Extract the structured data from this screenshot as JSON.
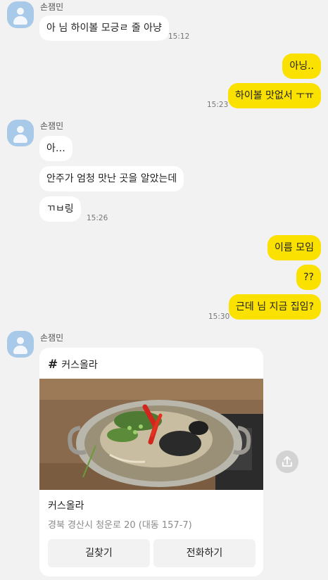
{
  "groups": [
    {
      "sender": "손잼민",
      "messages": [
        {
          "text": "아 님 하이볼 모긍ㄹ 줄 아냥",
          "time": "15:12"
        }
      ]
    },
    {
      "sender": "me",
      "messages": [
        {
          "text": "아닝.."
        },
        {
          "text": "하이볼 맛없서 ㅜㅠ",
          "time": "15:23"
        }
      ]
    },
    {
      "sender": "손잼민",
      "messages": [
        {
          "text": "아…"
        },
        {
          "text": "안주가 엄청 맛난 곳을 알았는데"
        },
        {
          "text": "ㄲㅂ링",
          "time": "15:26"
        }
      ]
    },
    {
      "sender": "me",
      "messages": [
        {
          "text": "이름 모임"
        },
        {
          "text": "??"
        },
        {
          "text": "근데 님 지금 집임?",
          "time": "15:30"
        }
      ]
    },
    {
      "sender": "손잼민",
      "place_card": {
        "hash": "#",
        "title": "커스올라",
        "place_name": "커스올라",
        "address": "경북 경산시 청운로 20 (대동 157-7)",
        "buttons": [
          "길찾기",
          "전화하기"
        ]
      }
    }
  ],
  "icons": {
    "avatar": "default-profile-icon",
    "share": "share-icon",
    "photo": "hot-pot-photo"
  },
  "colors": {
    "background": "#f2f2f2",
    "incoming_bubble": "#ffffff",
    "outgoing_bubble": "#fae100",
    "avatar": "#a9c9e8"
  }
}
